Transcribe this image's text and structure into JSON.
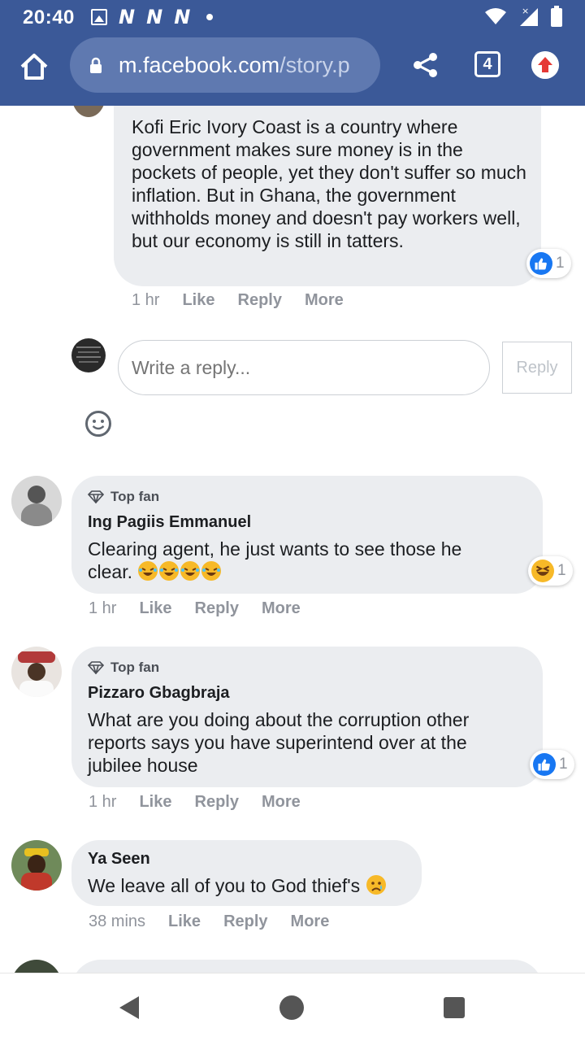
{
  "status_bar": {
    "time": "20:40",
    "n_icons": [
      "N",
      "N",
      "N"
    ]
  },
  "browser": {
    "url_domain": "m.facebook.com",
    "url_path": "/story.p",
    "tab_count": "4"
  },
  "colors": {
    "brand": "#3b5998",
    "bubble": "#ebedf0",
    "like_blue": "#1877f2",
    "meta_gray": "#90949c"
  },
  "comment_top": {
    "text": "Kofi Eric Ivory Coast is a country where government makes sure money is in the pockets of people, yet they don't suffer so much inflation. But in Ghana, the government withholds money and doesn't pay workers well, but our economy is still in tatters.",
    "reaction_count": "1",
    "time": "1 hr",
    "like": "Like",
    "reply": "Reply",
    "more": "More"
  },
  "reply_box": {
    "placeholder": "Write a reply...",
    "button": "Reply"
  },
  "comments": [
    {
      "badge": "Top fan",
      "name": "Ing Pagiis Emmanuel",
      "text": "Clearing agent, he just wants to see those he clear.",
      "emoji": "rolling-on-floor-laughing x4",
      "reaction_count": "1",
      "time": "1 hr",
      "like": "Like",
      "reply": "Reply",
      "more": "More"
    },
    {
      "badge": "Top fan",
      "name": "Pizzaro Gbagbraja",
      "text": "What are you doing about the corruption other reports says you have superintend over at the jubilee house",
      "reaction_count": "1",
      "time": "1 hr",
      "like": "Like",
      "reply": "Reply",
      "more": "More"
    },
    {
      "name": "Ya Seen",
      "text": "We leave all of you to God thief's",
      "emoji": "crying-face",
      "time": "38 mins",
      "like": "Like",
      "reply": "Reply",
      "more": "More"
    }
  ]
}
